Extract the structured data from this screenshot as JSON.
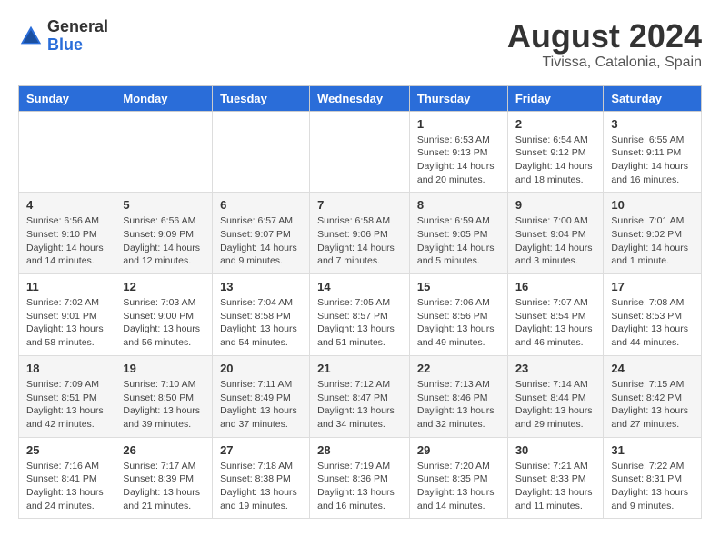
{
  "header": {
    "logo_general": "General",
    "logo_blue": "Blue",
    "month_year": "August 2024",
    "location": "Tivissa, Catalonia, Spain"
  },
  "weekdays": [
    "Sunday",
    "Monday",
    "Tuesday",
    "Wednesday",
    "Thursday",
    "Friday",
    "Saturday"
  ],
  "weeks": [
    [
      {
        "day": "",
        "info": ""
      },
      {
        "day": "",
        "info": ""
      },
      {
        "day": "",
        "info": ""
      },
      {
        "day": "",
        "info": ""
      },
      {
        "day": "1",
        "info": "Sunrise: 6:53 AM\nSunset: 9:13 PM\nDaylight: 14 hours and 20 minutes."
      },
      {
        "day": "2",
        "info": "Sunrise: 6:54 AM\nSunset: 9:12 PM\nDaylight: 14 hours and 18 minutes."
      },
      {
        "day": "3",
        "info": "Sunrise: 6:55 AM\nSunset: 9:11 PM\nDaylight: 14 hours and 16 minutes."
      }
    ],
    [
      {
        "day": "4",
        "info": "Sunrise: 6:56 AM\nSunset: 9:10 PM\nDaylight: 14 hours and 14 minutes."
      },
      {
        "day": "5",
        "info": "Sunrise: 6:56 AM\nSunset: 9:09 PM\nDaylight: 14 hours and 12 minutes."
      },
      {
        "day": "6",
        "info": "Sunrise: 6:57 AM\nSunset: 9:07 PM\nDaylight: 14 hours and 9 minutes."
      },
      {
        "day": "7",
        "info": "Sunrise: 6:58 AM\nSunset: 9:06 PM\nDaylight: 14 hours and 7 minutes."
      },
      {
        "day": "8",
        "info": "Sunrise: 6:59 AM\nSunset: 9:05 PM\nDaylight: 14 hours and 5 minutes."
      },
      {
        "day": "9",
        "info": "Sunrise: 7:00 AM\nSunset: 9:04 PM\nDaylight: 14 hours and 3 minutes."
      },
      {
        "day": "10",
        "info": "Sunrise: 7:01 AM\nSunset: 9:02 PM\nDaylight: 14 hours and 1 minute."
      }
    ],
    [
      {
        "day": "11",
        "info": "Sunrise: 7:02 AM\nSunset: 9:01 PM\nDaylight: 13 hours and 58 minutes."
      },
      {
        "day": "12",
        "info": "Sunrise: 7:03 AM\nSunset: 9:00 PM\nDaylight: 13 hours and 56 minutes."
      },
      {
        "day": "13",
        "info": "Sunrise: 7:04 AM\nSunset: 8:58 PM\nDaylight: 13 hours and 54 minutes."
      },
      {
        "day": "14",
        "info": "Sunrise: 7:05 AM\nSunset: 8:57 PM\nDaylight: 13 hours and 51 minutes."
      },
      {
        "day": "15",
        "info": "Sunrise: 7:06 AM\nSunset: 8:56 PM\nDaylight: 13 hours and 49 minutes."
      },
      {
        "day": "16",
        "info": "Sunrise: 7:07 AM\nSunset: 8:54 PM\nDaylight: 13 hours and 46 minutes."
      },
      {
        "day": "17",
        "info": "Sunrise: 7:08 AM\nSunset: 8:53 PM\nDaylight: 13 hours and 44 minutes."
      }
    ],
    [
      {
        "day": "18",
        "info": "Sunrise: 7:09 AM\nSunset: 8:51 PM\nDaylight: 13 hours and 42 minutes."
      },
      {
        "day": "19",
        "info": "Sunrise: 7:10 AM\nSunset: 8:50 PM\nDaylight: 13 hours and 39 minutes."
      },
      {
        "day": "20",
        "info": "Sunrise: 7:11 AM\nSunset: 8:49 PM\nDaylight: 13 hours and 37 minutes."
      },
      {
        "day": "21",
        "info": "Sunrise: 7:12 AM\nSunset: 8:47 PM\nDaylight: 13 hours and 34 minutes."
      },
      {
        "day": "22",
        "info": "Sunrise: 7:13 AM\nSunset: 8:46 PM\nDaylight: 13 hours and 32 minutes."
      },
      {
        "day": "23",
        "info": "Sunrise: 7:14 AM\nSunset: 8:44 PM\nDaylight: 13 hours and 29 minutes."
      },
      {
        "day": "24",
        "info": "Sunrise: 7:15 AM\nSunset: 8:42 PM\nDaylight: 13 hours and 27 minutes."
      }
    ],
    [
      {
        "day": "25",
        "info": "Sunrise: 7:16 AM\nSunset: 8:41 PM\nDaylight: 13 hours and 24 minutes."
      },
      {
        "day": "26",
        "info": "Sunrise: 7:17 AM\nSunset: 8:39 PM\nDaylight: 13 hours and 21 minutes."
      },
      {
        "day": "27",
        "info": "Sunrise: 7:18 AM\nSunset: 8:38 PM\nDaylight: 13 hours and 19 minutes."
      },
      {
        "day": "28",
        "info": "Sunrise: 7:19 AM\nSunset: 8:36 PM\nDaylight: 13 hours and 16 minutes."
      },
      {
        "day": "29",
        "info": "Sunrise: 7:20 AM\nSunset: 8:35 PM\nDaylight: 13 hours and 14 minutes."
      },
      {
        "day": "30",
        "info": "Sunrise: 7:21 AM\nSunset: 8:33 PM\nDaylight: 13 hours and 11 minutes."
      },
      {
        "day": "31",
        "info": "Sunrise: 7:22 AM\nSunset: 8:31 PM\nDaylight: 13 hours and 9 minutes."
      }
    ]
  ]
}
